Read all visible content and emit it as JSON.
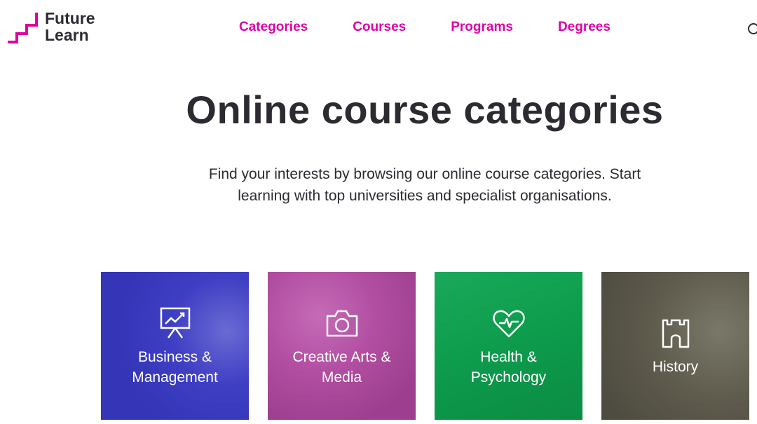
{
  "header": {
    "logo_line1": "Future",
    "logo_line2": "Learn",
    "nav": [
      "Categories",
      "Courses",
      "Programs",
      "Degrees"
    ]
  },
  "main": {
    "title": "Online course categories",
    "subtitle": "Find your interests by browsing our online course categories. Start learning with top universities and specialist organisations."
  },
  "categories": [
    {
      "label": "Business & Management",
      "icon": "presentation-chart-icon",
      "color": "#3b3bbf"
    },
    {
      "label": "Creative Arts & Media",
      "icon": "camera-icon",
      "color": "#b24ea2"
    },
    {
      "label": "Health & Psychology",
      "icon": "heartbeat-icon",
      "color": "#0f9d4f"
    },
    {
      "label": "History",
      "icon": "castle-icon",
      "color": "#5f5c4e"
    }
  ],
  "colors": {
    "brand": "#de00a5",
    "text": "#2d2a32"
  }
}
